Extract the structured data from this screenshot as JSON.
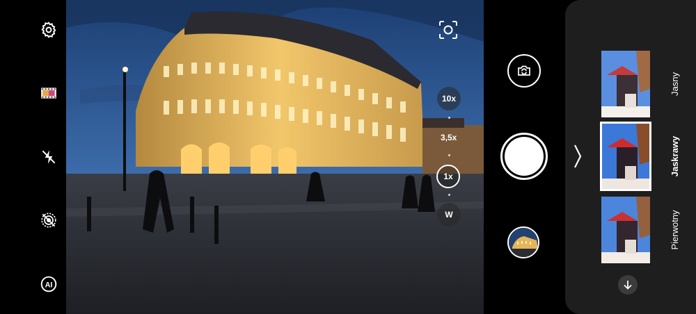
{
  "left_toolbar": {
    "items": [
      {
        "icon": "gear-icon"
      },
      {
        "icon": "filter-film-icon"
      },
      {
        "icon": "flash-off-icon"
      },
      {
        "icon": "live-photo-off-icon"
      },
      {
        "icon": "ai-icon"
      }
    ]
  },
  "viewfinder": {
    "scan_icon": "lens-scan-icon",
    "zoom": {
      "options": [
        "10x",
        "3,5x",
        "1x",
        "W"
      ],
      "selected": "1x"
    }
  },
  "controls": {
    "switch_icon": "camera-switch-icon",
    "shutter": "shutter-button",
    "gallery": "gallery-thumbnail"
  },
  "filters": {
    "items": [
      {
        "label": "Jasny",
        "selected": false
      },
      {
        "label": "Jaskrawy",
        "selected": true
      },
      {
        "label": "Pierwotny",
        "selected": false
      }
    ],
    "collapse_icon": "chevron-right-icon",
    "more_icon": "arrow-down-icon"
  },
  "colors": {
    "panel_bg": "#1e1e1e",
    "sky_top": "#1c3f73",
    "sky_bottom": "#4f82c0",
    "building_light": "#f2c66a"
  }
}
